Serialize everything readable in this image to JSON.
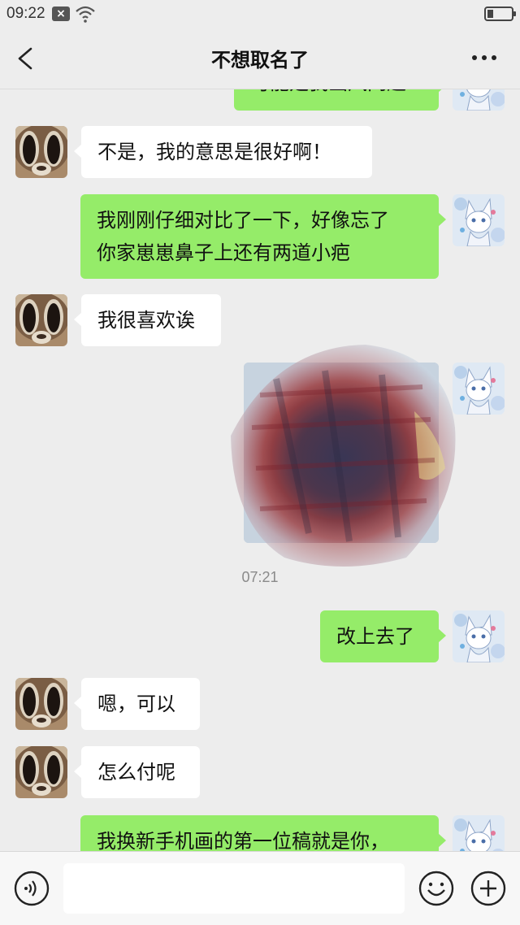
{
  "status_bar": {
    "time": "09:22",
    "notification_icon": "close-box-icon",
    "wifi_icon": "wifi-icon",
    "battery_icon": "battery-low-icon"
  },
  "header": {
    "title": "不想取名了",
    "back_icon": "chevron-left-icon",
    "more_icon": "ellipsis-icon"
  },
  "messages": [
    {
      "side": "right",
      "text": "可能是我画风问题",
      "partially_hidden": true
    },
    {
      "side": "left",
      "text": "不是，我的意思是很好啊！"
    },
    {
      "side": "right",
      "lines": [
        "我刚刚仔细对比了一下，好像忘了",
        "你家崽崽鼻子上还有两道小疤"
      ]
    },
    {
      "side": "left",
      "text": "我很喜欢诶"
    },
    {
      "side": "right",
      "type": "image",
      "content": "scribbled-out-image"
    },
    {
      "type": "timestamp",
      "text": "07:21"
    },
    {
      "side": "right",
      "text": "改上去了"
    },
    {
      "side": "left",
      "text": "嗯，可以"
    },
    {
      "side": "left",
      "text": "怎么付呢"
    },
    {
      "side": "right",
      "text": "我换新手机画的第一位稿就是你，",
      "partially_hidden": true
    }
  ],
  "input_bar": {
    "voice_icon": "voice-icon",
    "placeholder": "",
    "emoji_icon": "emoji-icon",
    "plus_icon": "plus-icon"
  },
  "colors": {
    "background": "#ededed",
    "bubble_sent": "#95ec69",
    "bubble_received": "#ffffff"
  }
}
